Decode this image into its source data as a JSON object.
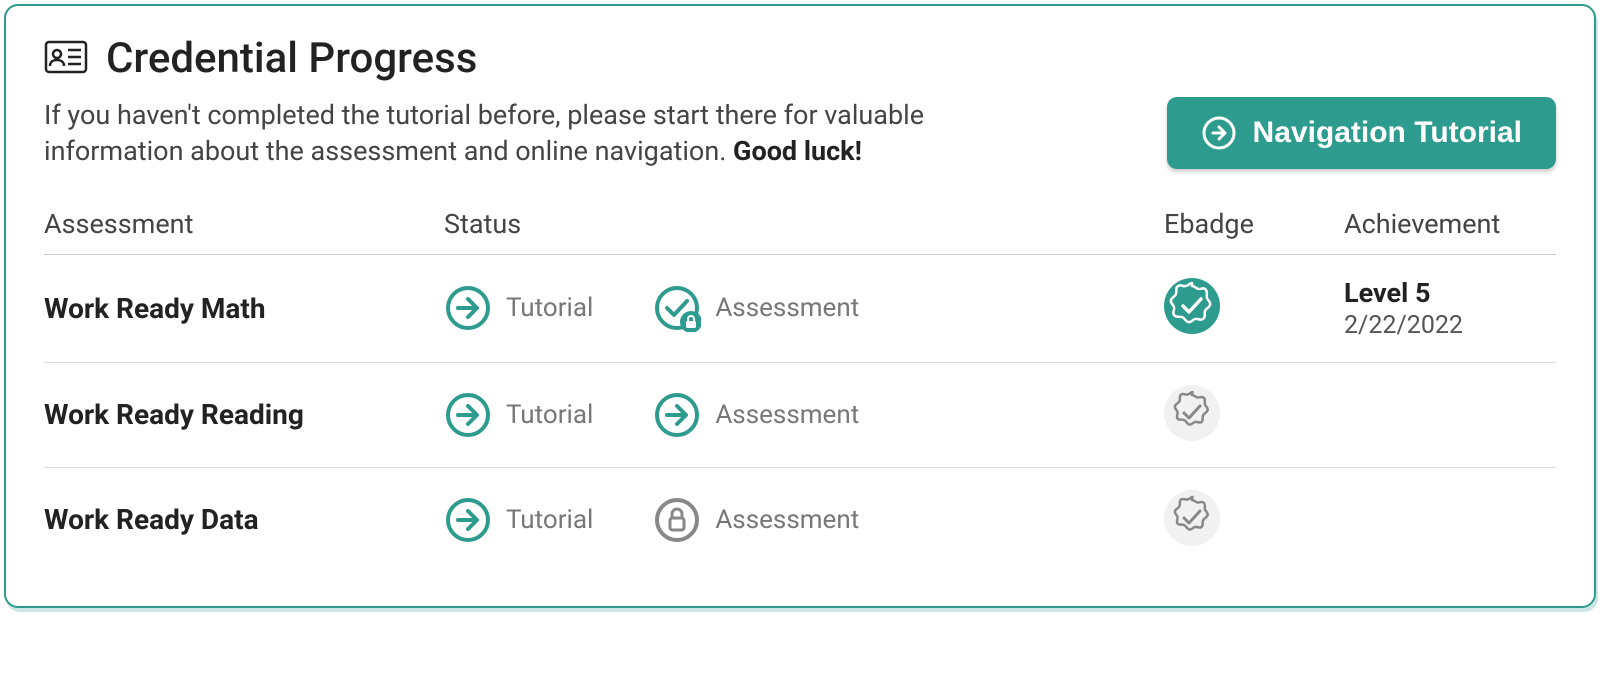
{
  "header": {
    "title": "Credential Progress"
  },
  "intro": {
    "text_before": "If you haven't completed the tutorial before, please start there for valuable information about the assessment and online navigation. ",
    "text_bold": "Good luck!"
  },
  "nav_button": {
    "label": "Navigation Tutorial"
  },
  "table": {
    "headers": {
      "assessment": "Assessment",
      "status": "Status",
      "ebadge": "Ebadge",
      "achievement": "Achievement"
    },
    "rows": [
      {
        "name": "Work Ready Math",
        "tutorial_label": "Tutorial",
        "tutorial_icon": "arrow",
        "assessment_label": "Assessment",
        "assessment_icon": "check-locked",
        "ebadge": "earned",
        "achievement_level": "Level 5",
        "achievement_date": "2/22/2022"
      },
      {
        "name": "Work Ready Reading",
        "tutorial_label": "Tutorial",
        "tutorial_icon": "arrow",
        "assessment_label": "Assessment",
        "assessment_icon": "arrow",
        "ebadge": "pending",
        "achievement_level": "",
        "achievement_date": ""
      },
      {
        "name": "Work Ready Data",
        "tutorial_label": "Tutorial",
        "tutorial_icon": "arrow",
        "assessment_label": "Assessment",
        "assessment_icon": "locked-gray",
        "ebadge": "pending",
        "achievement_level": "",
        "achievement_date": ""
      }
    ]
  },
  "colors": {
    "primary": "#2e9b8f",
    "gray": "#888"
  }
}
